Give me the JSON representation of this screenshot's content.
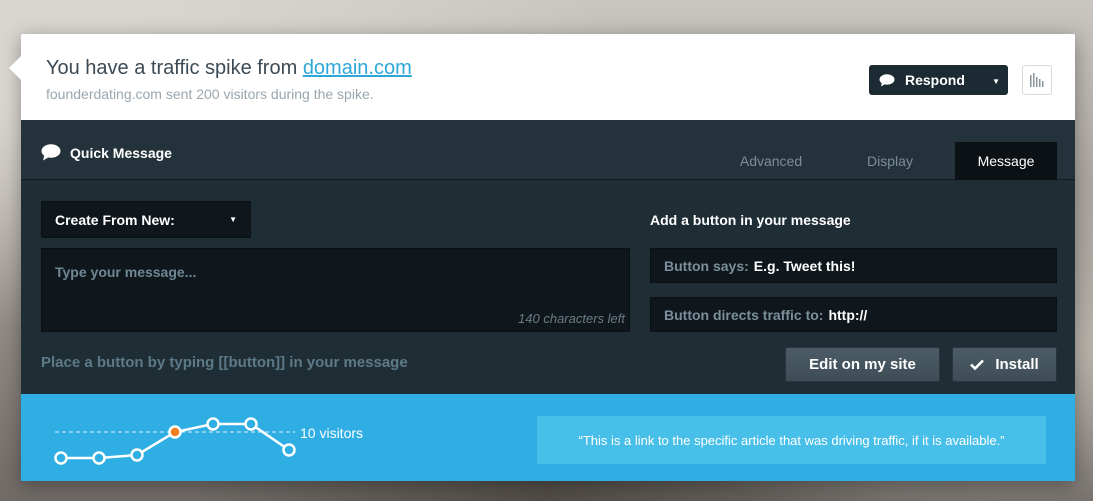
{
  "header": {
    "title_prefix": "You have a traffic spike from ",
    "title_link": "domain.com",
    "subtitle": "founderdating.com sent 200 visitors during the spike.",
    "respond_label": "Respond"
  },
  "quick_message": {
    "title": "Quick Message",
    "tabs": [
      {
        "label": "Advanced",
        "active": false
      },
      {
        "label": "Display",
        "active": false
      },
      {
        "label": "Message",
        "active": true
      }
    ],
    "create_select": "Create From New:",
    "message_placeholder": "Type your message...",
    "char_count": "140 characters left",
    "hint": "Place a button by typing [[button]] in your message",
    "add_button_label": "Add a button in your message",
    "button_says_label": "Button says:",
    "button_says_value": "E.g. Tweet this!",
    "button_directs_label": "Button directs traffic to:",
    "button_directs_value": "http://",
    "edit_label": "Edit on my site",
    "install_label": "Install"
  },
  "footer": {
    "visitors_label": "10 visitors",
    "quote": "“This is a link to the specific article that was driving traffic, if it is available.”",
    "highlight_color": "#f07f1f"
  },
  "colors": {
    "accent_blue": "#2eaee3",
    "dark_bg": "#1f2d35",
    "link": "#2ea7d8"
  }
}
